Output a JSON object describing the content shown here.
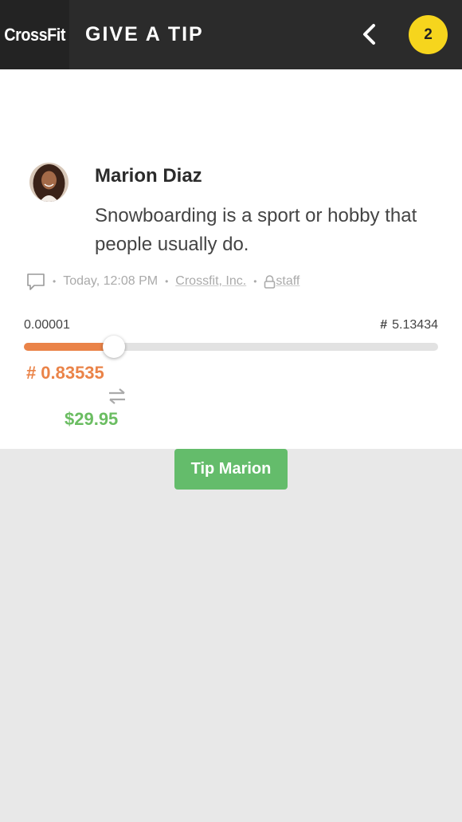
{
  "header": {
    "logo_text": "CrossFit",
    "title": "GIVE A TIP",
    "badge_count": "2",
    "back_icon": "chevron-left-icon",
    "badge_color": "#f6d51d"
  },
  "post": {
    "author": "Marion Diaz",
    "message": "Snowboarding is a sport or hobby that people usually do.",
    "timestamp": "Today, 12:08 PM",
    "organization": "Crossfit, Inc.",
    "visibility": "staff",
    "comment_icon": "comment-icon",
    "lock_icon": "lock-icon"
  },
  "tip": {
    "min_label": "0.00001",
    "coin_symbol": "#",
    "max_label": "5.13434",
    "slider_fraction": 0.217,
    "coin_amount": "0.83535",
    "usd_amount": "$29.95",
    "button_label": "Tip Marion",
    "accent_color": "#ea8348",
    "usd_color": "#6bbd62"
  }
}
